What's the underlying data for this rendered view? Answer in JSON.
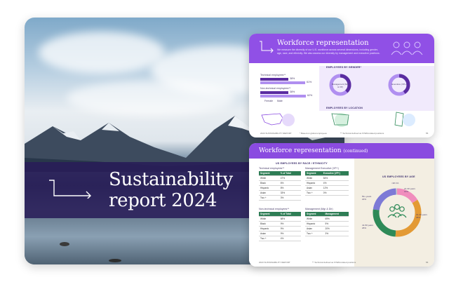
{
  "cover": {
    "title_line1": "Sustainability",
    "title_line2": "report 2024"
  },
  "card_workforce": {
    "title": "Workforce representation",
    "subtitle": "We measure the diversity of our U.S. workforce across several dimensions, including gender, age, race, and ethnicity. We also assess our diversity by management and executive positions.",
    "section_gender": "EMPLOYEES BY GENDER*",
    "bars": [
      {
        "label": "Technical employees**",
        "values": [
          "38%",
          "61%"
        ]
      },
      {
        "label": "Non-technical employees**",
        "values": [
          "38%",
          "62%"
        ]
      }
    ],
    "legend": [
      "Female",
      "Male"
    ],
    "donut1": {
      "label": "Management (Mgr & VP)",
      "left": "Male 62%",
      "right": "Female 38%"
    },
    "donut2": {
      "label": "Executive (VP+)",
      "left": "Male 59%",
      "right": "Female 41%"
    },
    "section_location": "EMPLOYEES BY LOCATION",
    "locations": [
      "US 83%",
      "17%",
      "India 2%",
      "Sweden 3%"
    ],
    "footer_left": "2023 SUSTAINABILITY REPORT",
    "footer_mid": "* Based on global employees",
    "footer_right": "** Technical defined as STEM-related positions",
    "page": "55"
  },
  "card_workforce_cont": {
    "title": "Workforce representation",
    "title_cont": "(continued)",
    "section_race": "US EMPLOYEES BY RACE / ETHNICITY",
    "tables": [
      {
        "caption": "Technical employees**",
        "head": [
          "Segment",
          "% of Total"
        ],
        "rows": [
          [
            "White",
            "47%"
          ],
          [
            "Black",
            "6%"
          ],
          [
            "Hispanic",
            "8%"
          ],
          [
            "Asian",
            "33%"
          ],
          [
            "Two +",
            "3%"
          ]
        ]
      },
      {
        "caption": "Management Executive (VP+)",
        "head": [
          "Segment",
          "Executive (VP+)"
        ],
        "rows": [
          [
            "White",
            "84%"
          ],
          [
            "Hispanic",
            "4%"
          ],
          [
            "Asian",
            "12%"
          ],
          [
            "Two +",
            "0%"
          ]
        ]
      },
      {
        "caption": "Non-technical employees**",
        "head": [
          "Segment",
          "% of Total"
        ],
        "rows": [
          [
            "White",
            "68%"
          ],
          [
            "Black",
            "9%"
          ],
          [
            "Hispanic",
            "9%"
          ],
          [
            "Asian",
            "9%"
          ],
          [
            "Two +",
            "4%"
          ]
        ]
      },
      {
        "caption": "Management (Mgr & Dir)",
        "head": [
          "Segment",
          "Management"
        ],
        "rows": [
          [
            "White",
            "69%"
          ],
          [
            "Hispanic",
            "5%"
          ],
          [
            "Asian",
            "20%"
          ],
          [
            "Two +",
            "3%"
          ]
        ]
      }
    ],
    "section_age": "US EMPLOYEES BY AGE",
    "age_segments": [
      {
        "label": "21-30 years 16%",
        "value": 16,
        "color": "#f08dbd"
      },
      {
        "label": "31-40 years 35%",
        "value": 35,
        "color": "#e39a35"
      },
      {
        "label": "41-50 years 26%",
        "value": 26,
        "color": "#2e8a58"
      },
      {
        "label": "50+ years 22%",
        "value": 22,
        "color": "#7d7ad6"
      },
      {
        "label": "<20 1%",
        "value": 1,
        "color": "#c9c9c9"
      }
    ],
    "footer_left": "2023 SUSTAINABILITY REPORT",
    "footer_mid": "** Technical defined as STEM-related positions",
    "page": "56"
  }
}
